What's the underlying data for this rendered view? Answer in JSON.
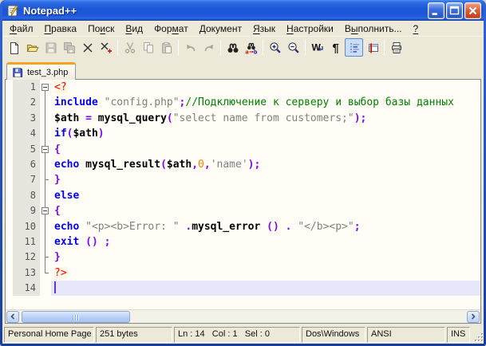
{
  "window": {
    "title": "Notepad++"
  },
  "menu": {
    "items": [
      {
        "id": "file",
        "pre": "",
        "key": "Ф",
        "post": "айл"
      },
      {
        "id": "edit",
        "pre": "",
        "key": "П",
        "post": "равка"
      },
      {
        "id": "search",
        "pre": "По",
        "key": "и",
        "post": "ск"
      },
      {
        "id": "view",
        "pre": "",
        "key": "В",
        "post": "ид"
      },
      {
        "id": "format",
        "pre": "Фор",
        "key": "м",
        "post": "ат"
      },
      {
        "id": "document",
        "pre": "",
        "key": "Д",
        "post": "окумент"
      },
      {
        "id": "language",
        "pre": "",
        "key": "Я",
        "post": "зык"
      },
      {
        "id": "settings",
        "pre": "",
        "key": "Н",
        "post": "астройки"
      },
      {
        "id": "run",
        "pre": "В",
        "key": "ы",
        "post": "полнить..."
      },
      {
        "id": "help",
        "pre": "",
        "key": "?",
        "post": ""
      }
    ]
  },
  "toolbar": {
    "items": [
      {
        "id": "new",
        "icon": "new-file-icon",
        "state": "normal"
      },
      {
        "id": "open",
        "icon": "open-file-icon",
        "state": "normal"
      },
      {
        "id": "save",
        "icon": "save-icon",
        "state": "disabled"
      },
      {
        "id": "saveall",
        "icon": "save-all-icon",
        "state": "disabled"
      },
      {
        "id": "close",
        "icon": "close-file-icon",
        "state": "normal"
      },
      {
        "id": "closeall",
        "icon": "close-all-icon",
        "state": "normal"
      },
      "sep",
      {
        "id": "cut",
        "icon": "cut-icon",
        "state": "disabled"
      },
      {
        "id": "copy",
        "icon": "copy-icon",
        "state": "disabled"
      },
      {
        "id": "paste",
        "icon": "paste-icon",
        "state": "disabled"
      },
      "sep",
      {
        "id": "undo",
        "icon": "undo-icon",
        "state": "disabled"
      },
      {
        "id": "redo",
        "icon": "redo-icon",
        "state": "disabled"
      },
      "sep",
      {
        "id": "find",
        "icon": "find-icon",
        "state": "normal"
      },
      {
        "id": "replace",
        "icon": "replace-icon",
        "state": "normal"
      },
      "sep",
      {
        "id": "zoomin",
        "icon": "zoom-in-icon",
        "state": "normal"
      },
      {
        "id": "zoomout",
        "icon": "zoom-out-icon",
        "state": "normal"
      },
      "sep",
      {
        "id": "wordwrap",
        "icon": "word-wrap-icon",
        "state": "normal"
      },
      {
        "id": "showall",
        "icon": "show-all-characters-icon",
        "state": "normal"
      },
      {
        "id": "indentguide",
        "icon": "indent-guide-icon",
        "state": "active"
      },
      {
        "id": "docswitch",
        "icon": "doc-switcher-icon",
        "state": "normal"
      },
      "sep",
      {
        "id": "print",
        "icon": "print-icon",
        "state": "normal"
      }
    ]
  },
  "tabs": [
    {
      "label": "test_3.php",
      "active": true,
      "saved": true
    }
  ],
  "editor": {
    "styles": {
      "tag": {
        "color": "#FF0000",
        "bg": "#FDF8E3"
      },
      "keyword": {
        "color": "#0000FF",
        "bold": true
      },
      "string": {
        "color": "#808080"
      },
      "comment": {
        "color": "#008000"
      },
      "number": {
        "color": "#FF8000"
      },
      "ident": {
        "color": "#000000",
        "bold": true
      },
      "op": {
        "color": "#8000FF",
        "bold": true
      },
      "plain": {
        "color": "#000000"
      }
    },
    "colors": {
      "current_line_bg": "#E7E7FC",
      "caret": "#6C35C8",
      "tab_accent": "#F9A021"
    },
    "lines": [
      {
        "n": "1",
        "fold": "box-first",
        "tokens": [
          [
            "tag",
            "<?"
          ]
        ]
      },
      {
        "n": "2",
        "fold": "line",
        "tokens": [
          [
            "keyword",
            "include"
          ],
          [
            "plain",
            " "
          ],
          [
            "string",
            "\"config.php\""
          ],
          [
            "op",
            ";"
          ],
          [
            "comment",
            "//Подключение к серверу и выбор базы данных"
          ]
        ]
      },
      {
        "n": "3",
        "fold": "line",
        "tokens": [
          [
            "ident",
            "$ath"
          ],
          [
            "plain",
            " "
          ],
          [
            "op",
            "="
          ],
          [
            "plain",
            " "
          ],
          [
            "ident",
            "mysql_query"
          ],
          [
            "op",
            "("
          ],
          [
            "string",
            "\"select name from customers;\""
          ],
          [
            "op",
            ");"
          ]
        ]
      },
      {
        "n": "4",
        "fold": "line",
        "tokens": [
          [
            "keyword",
            "if"
          ],
          [
            "op",
            "("
          ],
          [
            "ident",
            "$ath"
          ],
          [
            "op",
            ")"
          ]
        ]
      },
      {
        "n": "5",
        "fold": "box",
        "tokens": [
          [
            "op",
            "{"
          ]
        ]
      },
      {
        "n": "6",
        "fold": "line",
        "tokens": [
          [
            "keyword",
            "echo"
          ],
          [
            "plain",
            " "
          ],
          [
            "ident",
            "mysql_result"
          ],
          [
            "op",
            "("
          ],
          [
            "ident",
            "$ath"
          ],
          [
            "op",
            ","
          ],
          [
            "number",
            "0"
          ],
          [
            "op",
            ","
          ],
          [
            "string",
            "'name'"
          ],
          [
            "op",
            ");"
          ]
        ]
      },
      {
        "n": "7",
        "fold": "tick",
        "tokens": [
          [
            "op",
            "}"
          ]
        ]
      },
      {
        "n": "8",
        "fold": "line",
        "tokens": [
          [
            "keyword",
            "else"
          ]
        ]
      },
      {
        "n": "9",
        "fold": "box",
        "tokens": [
          [
            "op",
            "{"
          ]
        ]
      },
      {
        "n": "10",
        "fold": "line",
        "tokens": [
          [
            "keyword",
            "echo"
          ],
          [
            "plain",
            " "
          ],
          [
            "string",
            "\"<p><b>Error: \""
          ],
          [
            "plain",
            " "
          ],
          [
            "op",
            "."
          ],
          [
            "ident",
            "mysql_error"
          ],
          [
            "plain",
            " "
          ],
          [
            "op",
            "()"
          ],
          [
            "plain",
            " "
          ],
          [
            "op",
            "."
          ],
          [
            "plain",
            " "
          ],
          [
            "string",
            "\"</b><p>\""
          ],
          [
            "op",
            ";"
          ]
        ]
      },
      {
        "n": "11",
        "fold": "line",
        "tokens": [
          [
            "keyword",
            "exit"
          ],
          [
            "plain",
            " "
          ],
          [
            "op",
            "()"
          ],
          [
            "plain",
            " "
          ],
          [
            "op",
            ";"
          ]
        ]
      },
      {
        "n": "12",
        "fold": "tick",
        "tokens": [
          [
            "op",
            "}"
          ]
        ]
      },
      {
        "n": "13",
        "fold": "end",
        "tokens": [
          [
            "tag",
            "?>"
          ]
        ]
      },
      {
        "n": "14",
        "fold": "none",
        "current": true,
        "caret": true,
        "tokens": []
      }
    ]
  },
  "statusbar": {
    "fields": [
      {
        "id": "doc-type",
        "text": "Personal Home Page language"
      },
      {
        "id": "file-size",
        "text": "251 bytes"
      },
      {
        "id": "cursor-position",
        "text": "Ln : 14   Col : 1   Sel : 0"
      },
      {
        "id": "eol-format",
        "text": "Dos\\Windows"
      },
      {
        "id": "encoding",
        "text": "ANSI"
      },
      {
        "id": "insert-mode",
        "text": "INS"
      }
    ]
  }
}
